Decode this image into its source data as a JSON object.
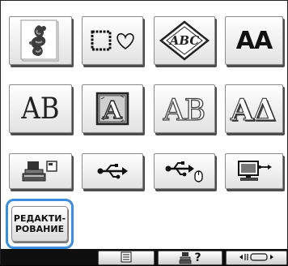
{
  "colors": {
    "accent": "#3b8de0",
    "tile_shadow": "#4d4d4d",
    "bar": "#0e0e0e"
  },
  "grid": {
    "row1": [
      {
        "name": "embroidery-pattern",
        "icon": "peacock-embroidery-icon"
      },
      {
        "name": "frame-shapes",
        "icon": "square-heart-frame-icon"
      },
      {
        "name": "monogram",
        "icon": "abc-monogram-diamond-icon",
        "text": "ABC"
      },
      {
        "name": "font-alphabet",
        "icon": "letters-icon",
        "text": "AA"
      }
    ],
    "row2": [
      {
        "name": "serif-alphabet",
        "icon": "serif-letters-icon",
        "text": "AB"
      },
      {
        "name": "decorative-alphabet",
        "icon": "ornate-a-icon",
        "text": "A"
      },
      {
        "name": "outline-alphabet",
        "icon": "outline-letters-icon",
        "text": "AB"
      },
      {
        "name": "3d-alphabet",
        "icon": "3d-letters-icon",
        "text": "AΔ"
      }
    ],
    "row3": [
      {
        "name": "machine-memory",
        "icon": "embroidery-machine-icon"
      },
      {
        "name": "usb-media",
        "icon": "usb-icon"
      },
      {
        "name": "usb-mouse",
        "icon": "usb-mouse-icon"
      },
      {
        "name": "computer",
        "icon": "computer-usb-icon"
      }
    ]
  },
  "edit_button": {
    "line1": "РЕДАКТИ-",
    "line2": "РОВАНИЕ"
  },
  "bottom_bar": {
    "list_icon": "list-icon",
    "help_icon": "machine-help-icon",
    "help_text": "?",
    "frame_icon": "frame-move-icon"
  }
}
